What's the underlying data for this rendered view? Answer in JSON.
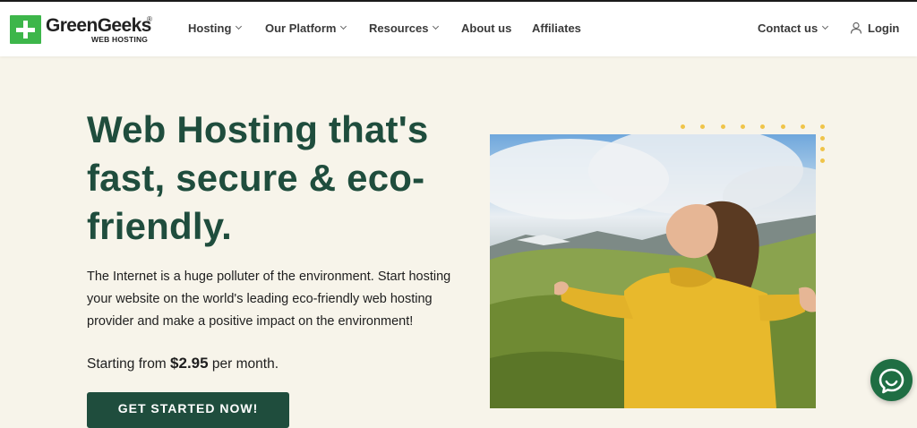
{
  "brand": {
    "name": "GreenGeeks",
    "registered": "®",
    "subtitle": "WEB HOSTING"
  },
  "nav": {
    "items": [
      {
        "label": "Hosting",
        "dropdown": true
      },
      {
        "label": "Our Platform",
        "dropdown": true
      },
      {
        "label": "Resources",
        "dropdown": true
      },
      {
        "label": "About us",
        "dropdown": false
      },
      {
        "label": "Affiliates",
        "dropdown": false
      }
    ],
    "contact": "Contact us",
    "login": "Login"
  },
  "hero": {
    "title": "Web Hosting that's fast, secure & eco-friendly.",
    "description": "The Internet is a huge polluter of the environment. Start hosting your website on the world's leading eco-friendly web hosting provider and make a positive impact on the environment!",
    "price_prefix": "Starting from",
    "price": "$2.95",
    "price_suffix": "per month.",
    "cta": "GET STARTED NOW!"
  },
  "colors": {
    "brand_green": "#3db64a",
    "dark_green": "#1f4d3d",
    "background": "#f7f4ea",
    "accent_yellow": "#efc44a"
  },
  "icons": {
    "user": "user-icon",
    "chat": "chat-icon"
  }
}
